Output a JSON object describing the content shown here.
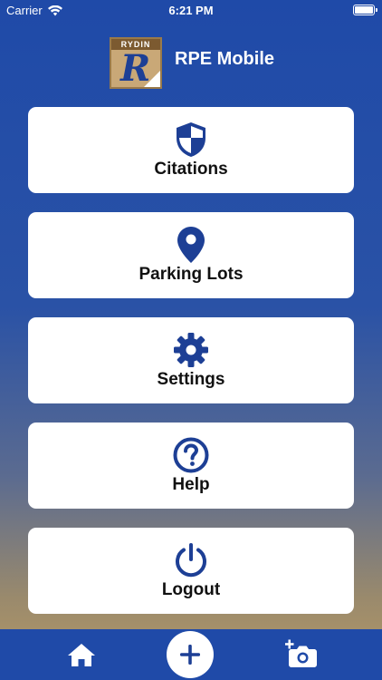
{
  "status_bar": {
    "carrier": "Carrier",
    "time": "6:21 PM"
  },
  "header": {
    "logo_text": "RYDIN",
    "logo_letter": "R",
    "app_title": "RPE Mobile"
  },
  "menu": [
    {
      "label": "Citations",
      "icon": "shield-icon"
    },
    {
      "label": "Parking Lots",
      "icon": "map-pin-icon"
    },
    {
      "label": "Settings",
      "icon": "gear-icon"
    },
    {
      "label": "Help",
      "icon": "question-circle-icon"
    },
    {
      "label": "Logout",
      "icon": "power-icon"
    }
  ],
  "tab_bar": {
    "items": [
      {
        "icon": "home-icon"
      },
      {
        "icon": "plus-icon"
      },
      {
        "icon": "add-photo-icon"
      }
    ]
  },
  "colors": {
    "primary_blue": "#1f4aa8",
    "icon_blue": "#1d3f95",
    "card_bg": "#ffffff"
  }
}
